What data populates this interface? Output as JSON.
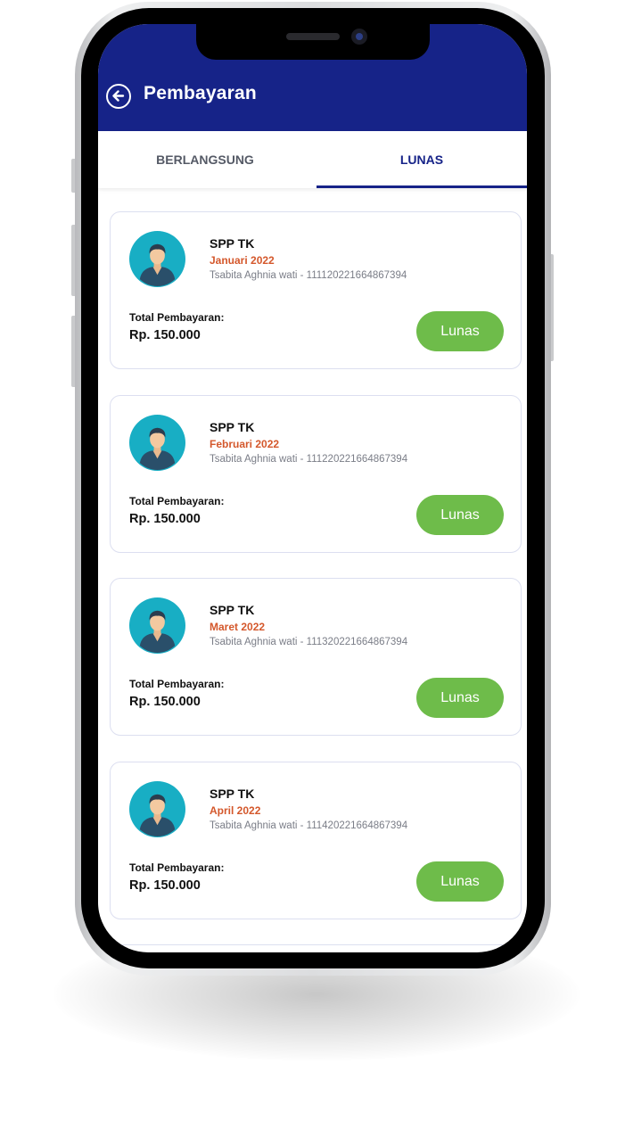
{
  "header": {
    "title": "Pembayaran"
  },
  "tabs": [
    {
      "label": "BERLANGSUNG",
      "active": false
    },
    {
      "label": "LUNAS",
      "active": true
    }
  ],
  "payments": [
    {
      "title": "SPP TK",
      "month": "Januari 2022",
      "subtitle": "Tsabita Aghnia wati - 111120221664867394",
      "total_label": "Total Pembayaran:",
      "amount": "Rp. 150.000",
      "status": "Lunas"
    },
    {
      "title": "SPP TK",
      "month": "Februari 2022",
      "subtitle": "Tsabita Aghnia wati - 111220221664867394",
      "total_label": "Total Pembayaran:",
      "amount": "Rp. 150.000",
      "status": "Lunas"
    },
    {
      "title": "SPP TK",
      "month": "Maret 2022",
      "subtitle": "Tsabita Aghnia wati - 111320221664867394",
      "total_label": "Total Pembayaran:",
      "amount": "Rp. 150.000",
      "status": "Lunas"
    },
    {
      "title": "SPP TK",
      "month": "April 2022",
      "subtitle": "Tsabita Aghnia wati - 111420221664867394",
      "total_label": "Total Pembayaran:",
      "amount": "Rp. 150.000",
      "status": "Lunas"
    }
  ],
  "colors": {
    "header_bg": "#162388",
    "month_text": "#d4582c",
    "status_bg": "#6ebc4a",
    "avatar_bg": "#18aec4"
  },
  "icons": {
    "back": "arrow-left-circle-icon",
    "avatar": "student-avatar-icon"
  }
}
